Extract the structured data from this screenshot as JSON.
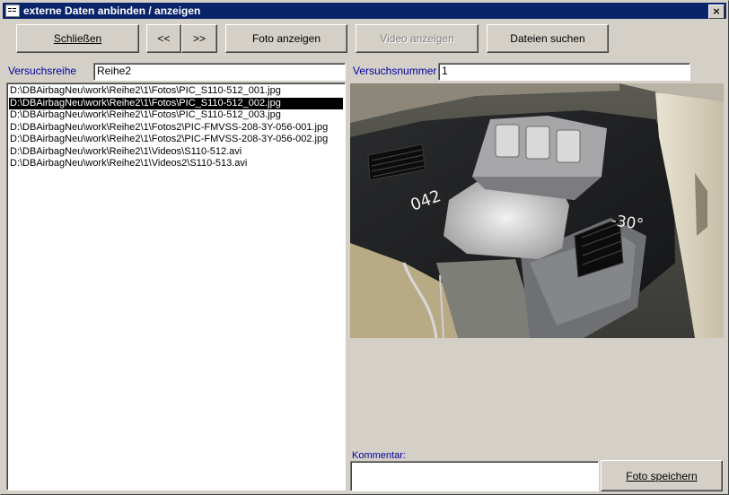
{
  "window": {
    "title": "externe Daten anbinden / anzeigen",
    "close_glyph": "×"
  },
  "toolbar": {
    "close_label": "Schließen",
    "prev_label": "<<",
    "next_label": ">>",
    "show_photo_label": "Foto anzeigen",
    "show_video_label": "Video anzeigen",
    "search_files_label": "Dateien suchen"
  },
  "fields": {
    "versuchsreihe_label": "Versuchsreihe",
    "versuchsreihe_value": "Reihe2",
    "versuchsnummer_label": "Versuchsnummer",
    "versuchsnummer_value": "1",
    "kommentar_label": "Kommentar:",
    "kommentar_value": ""
  },
  "files": [
    "D:\\DBAirbagNeu\\work\\Reihe2\\1\\Fotos\\PIC_S110-512_001.jpg",
    "D:\\DBAirbagNeu\\work\\Reihe2\\1\\Fotos\\PIC_S110-512_002.jpg",
    "D:\\DBAirbagNeu\\work\\Reihe2\\1\\Fotos\\PIC_S110-512_003.jpg",
    "D:\\DBAirbagNeu\\work\\Reihe2\\1\\Fotos2\\PIC-FMVSS-208-3Y-056-001.jpg",
    "D:\\DBAirbagNeu\\work\\Reihe2\\1\\Fotos2\\PIC-FMVSS-208-3Y-056-002.jpg",
    "D:\\DBAirbagNeu\\work\\Reihe2\\1\\Videos\\S110-512.avi",
    "D:\\DBAirbagNeu\\work\\Reihe2\\1\\Videos2\\S110-513.avi"
  ],
  "selected_file_index": 1,
  "save_photo_label": "Foto speichern",
  "photo": {
    "annotation_left": "042",
    "annotation_right": "-30°"
  },
  "colors": {
    "title_bar": "#0a246a",
    "label_text": "#0000a0",
    "face": "#d4d0c8"
  }
}
